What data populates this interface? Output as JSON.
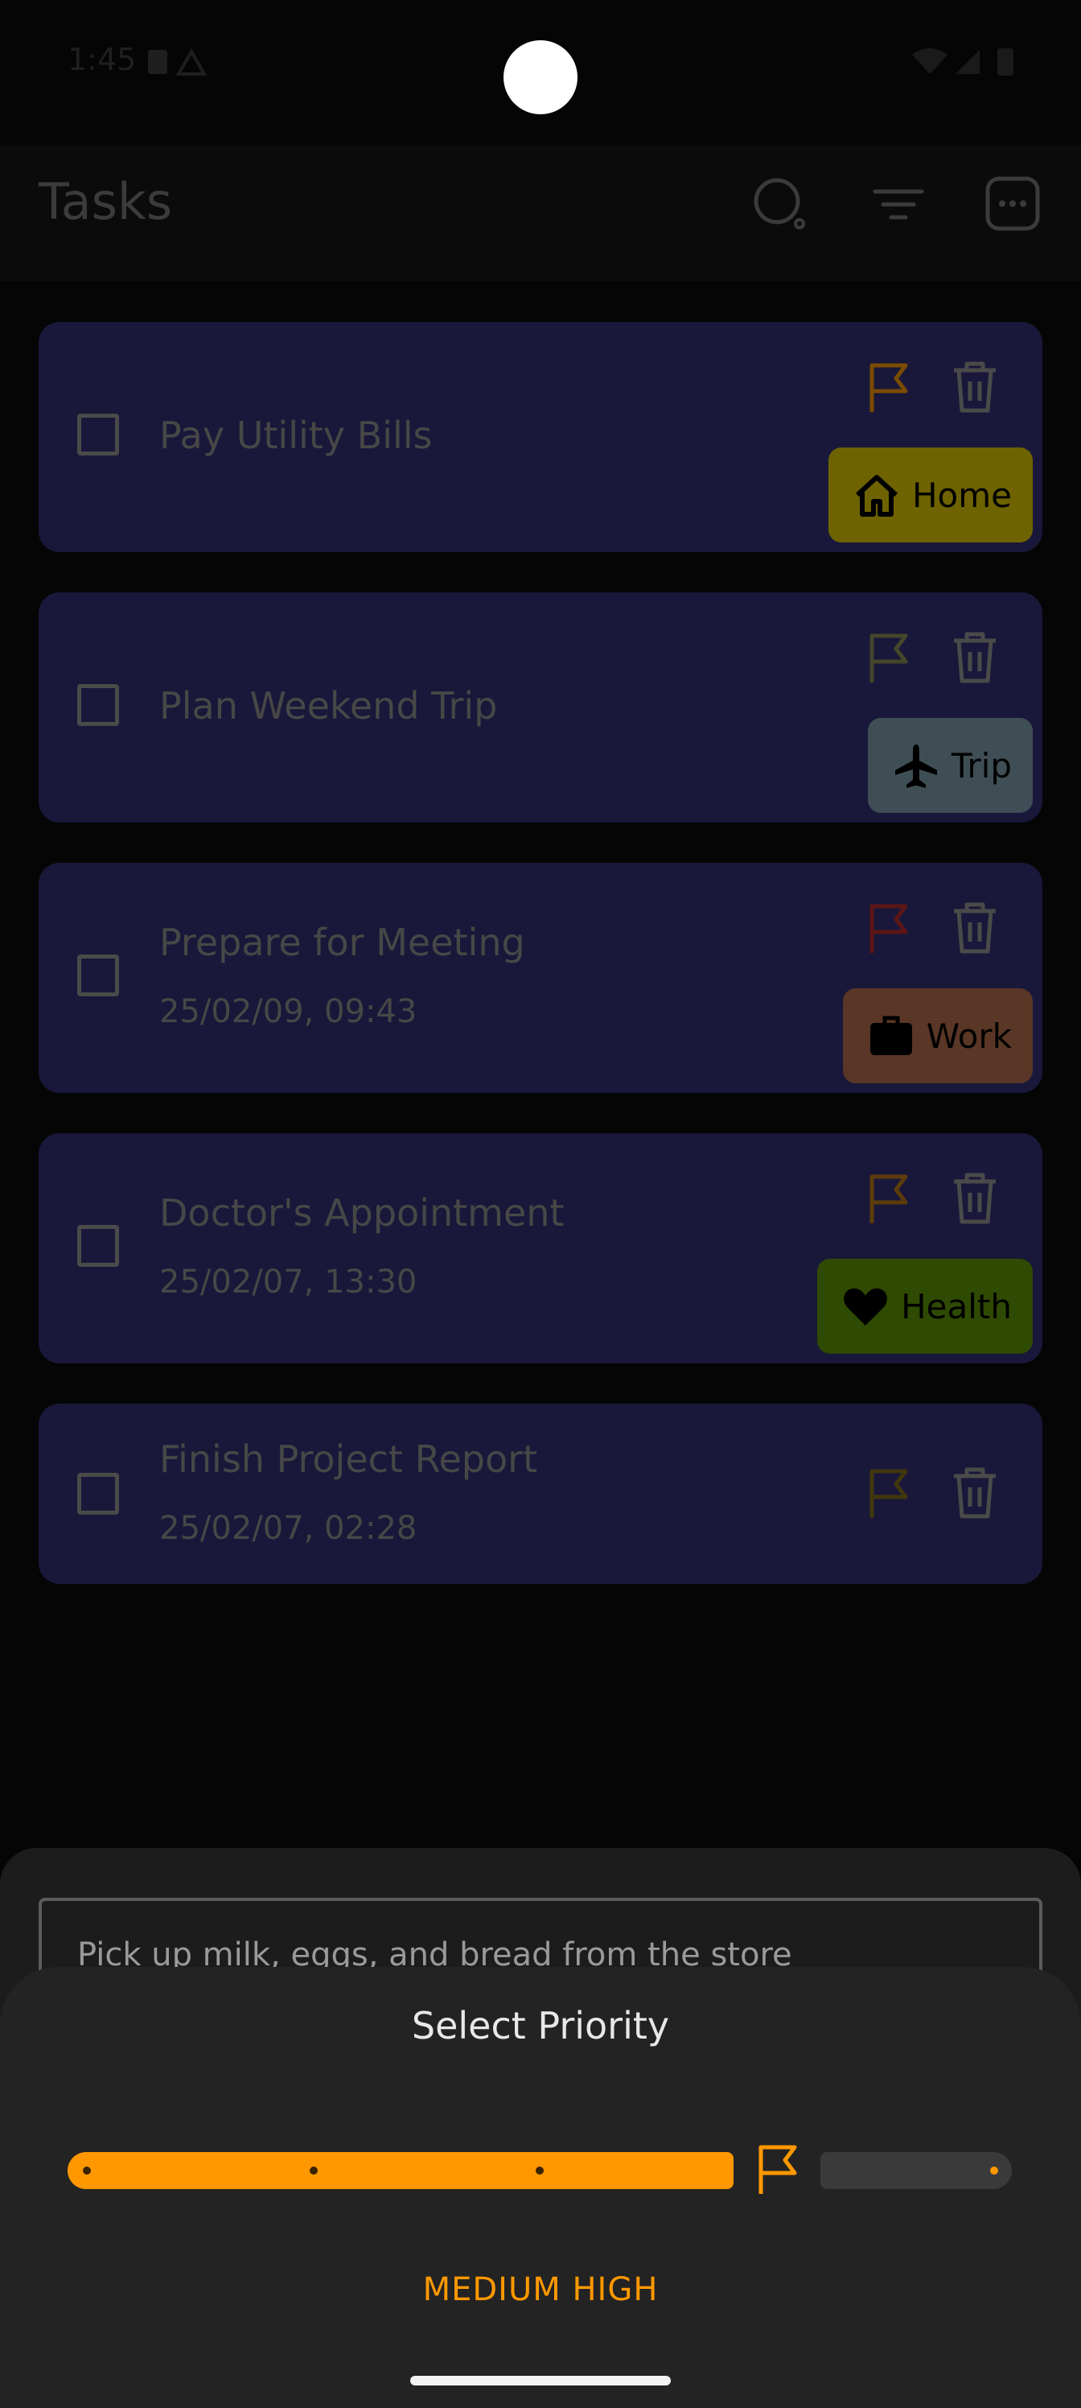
{
  "status_bar": {
    "time": "1:45"
  },
  "app_bar": {
    "title": "Tasks"
  },
  "tasks": [
    {
      "title": "Pay Utility Bills",
      "date": "",
      "flag_color": "#7a4b00",
      "tag": {
        "label": "Home",
        "icon": "home-icon",
        "color": "#6e6300"
      }
    },
    {
      "title": "Plan Weekend Trip",
      "date": "",
      "flag_color": "#45462a",
      "tag": {
        "label": "Trip",
        "icon": "airplane-icon",
        "color": "#3f4e55"
      }
    },
    {
      "title": "Prepare for Meeting",
      "date": "25/02/09, 09:43",
      "flag_color": "#5c1616",
      "tag": {
        "label": "Work",
        "icon": "briefcase-icon",
        "color": "#5a3626"
      }
    },
    {
      "title": "Doctor's Appointment",
      "date": "25/02/07, 13:30",
      "flag_color": "#5c3c0a",
      "tag": {
        "label": "Health",
        "icon": "heart-icon",
        "color": "#2f4a02"
      }
    },
    {
      "title": "Finish Project Report",
      "date": "25/02/07, 02:28",
      "flag_color": "#40370e",
      "tag": null
    }
  ],
  "task_sheet": {
    "description": "Pick up milk, eggs, and bread from the store"
  },
  "priority_sheet": {
    "title": "Select Priority",
    "selected_level_index": 4,
    "level_count": 5,
    "selected_label": "MEDIUM HIGH",
    "accent_color": "#ff9800"
  }
}
